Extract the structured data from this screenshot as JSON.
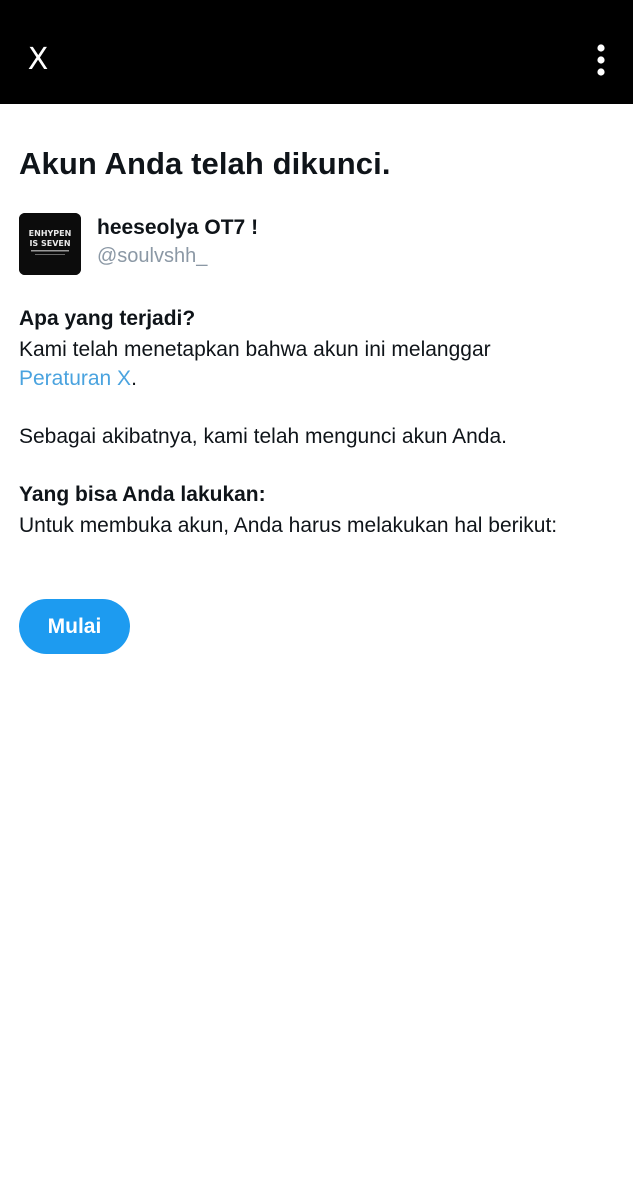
{
  "topbar": {
    "close_label": "X",
    "menu_icon": "more-vertical-icon"
  },
  "page": {
    "title": "Akun Anda telah dikunci."
  },
  "account": {
    "display_name": "heeseolya OT7 !",
    "handle": "@soulvshh_",
    "avatar_lines": [
      "ENHYPEN",
      "IS SEVEN"
    ]
  },
  "what_happened": {
    "heading": "Apa yang terjadi?",
    "text_before_link": "Kami telah menetapkan bahwa akun ini melanggar",
    "link": "Peraturan X",
    "text_after_link": ".",
    "consequence": "Sebagai akibatnya, kami telah mengunci akun Anda."
  },
  "what_you_can_do": {
    "heading": "Yang bisa Anda lakukan:",
    "text": "Untuk membuka akun, Anda harus melakukan hal berikut:"
  },
  "actions": {
    "start_label": "Mulai"
  },
  "colors": {
    "topbar": "#000000",
    "accent": "#1d9bf0",
    "link": "#4aa3df",
    "muted": "#8b98a5"
  }
}
